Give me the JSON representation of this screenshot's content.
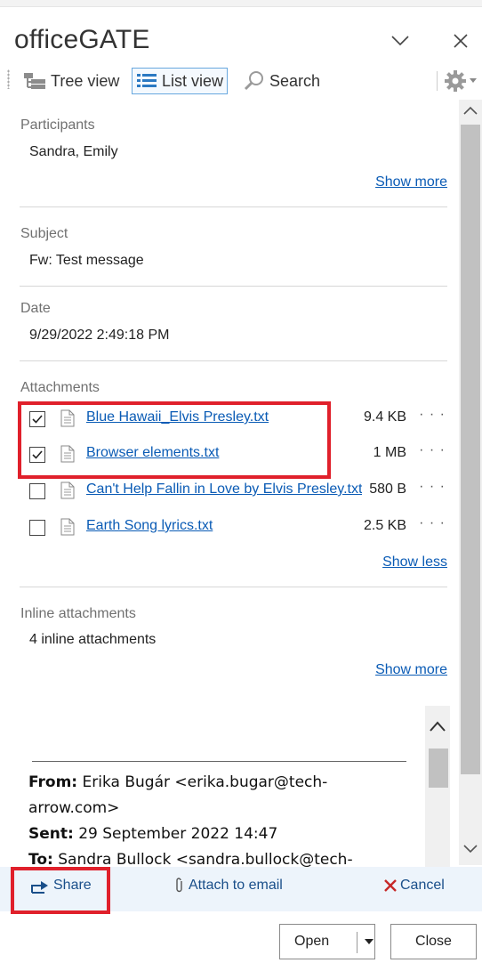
{
  "app": {
    "title": "officeGATE"
  },
  "toolbar": {
    "tree_view": "Tree view",
    "list_view": "List view",
    "search": "Search"
  },
  "participants": {
    "label": "Participants",
    "value": "Sandra, Emily",
    "show_more": "Show more"
  },
  "subject": {
    "label": "Subject",
    "value": "Fw: Test message"
  },
  "date": {
    "label": "Date",
    "value": "9/29/2022 2:49:18 PM"
  },
  "attachments": {
    "label": "Attachments",
    "show_less": "Show less",
    "more": "· · ·",
    "items": [
      {
        "name": "Blue Hawaii_Elvis Presley.txt",
        "size": "9.4 KB",
        "checked": true
      },
      {
        "name": "Browser elements.txt",
        "size": "1 MB",
        "checked": true
      },
      {
        "name": "Can't Help Fallin in Love by Elvis Presley.txt",
        "size": "580 B",
        "checked": false
      },
      {
        "name": "Earth Song lyrics.txt",
        "size": "2.5 KB",
        "checked": false
      }
    ]
  },
  "inline": {
    "label": "Inline attachments",
    "value": "4 inline attachments",
    "show_more": "Show more"
  },
  "preview": {
    "from_label": "From:",
    "from_value": "Erika Bugár <erika.bugar@tech-arrow.com>",
    "sent_label": "Sent:",
    "sent_value": "29 September 2022 14:47",
    "to_label": "To:",
    "to_value": "Sandra Bullock <sandra.bullock@tech-arrow.com>"
  },
  "actions": {
    "share": "Share",
    "attach": "Attach to email",
    "cancel": "Cancel"
  },
  "buttons": {
    "open": "Open",
    "close": "Close"
  },
  "colors": {
    "link": "#0a5bb5",
    "highlight": "#e0202b",
    "action_bg": "#edf4fb",
    "cancel_x": "#c62828"
  }
}
